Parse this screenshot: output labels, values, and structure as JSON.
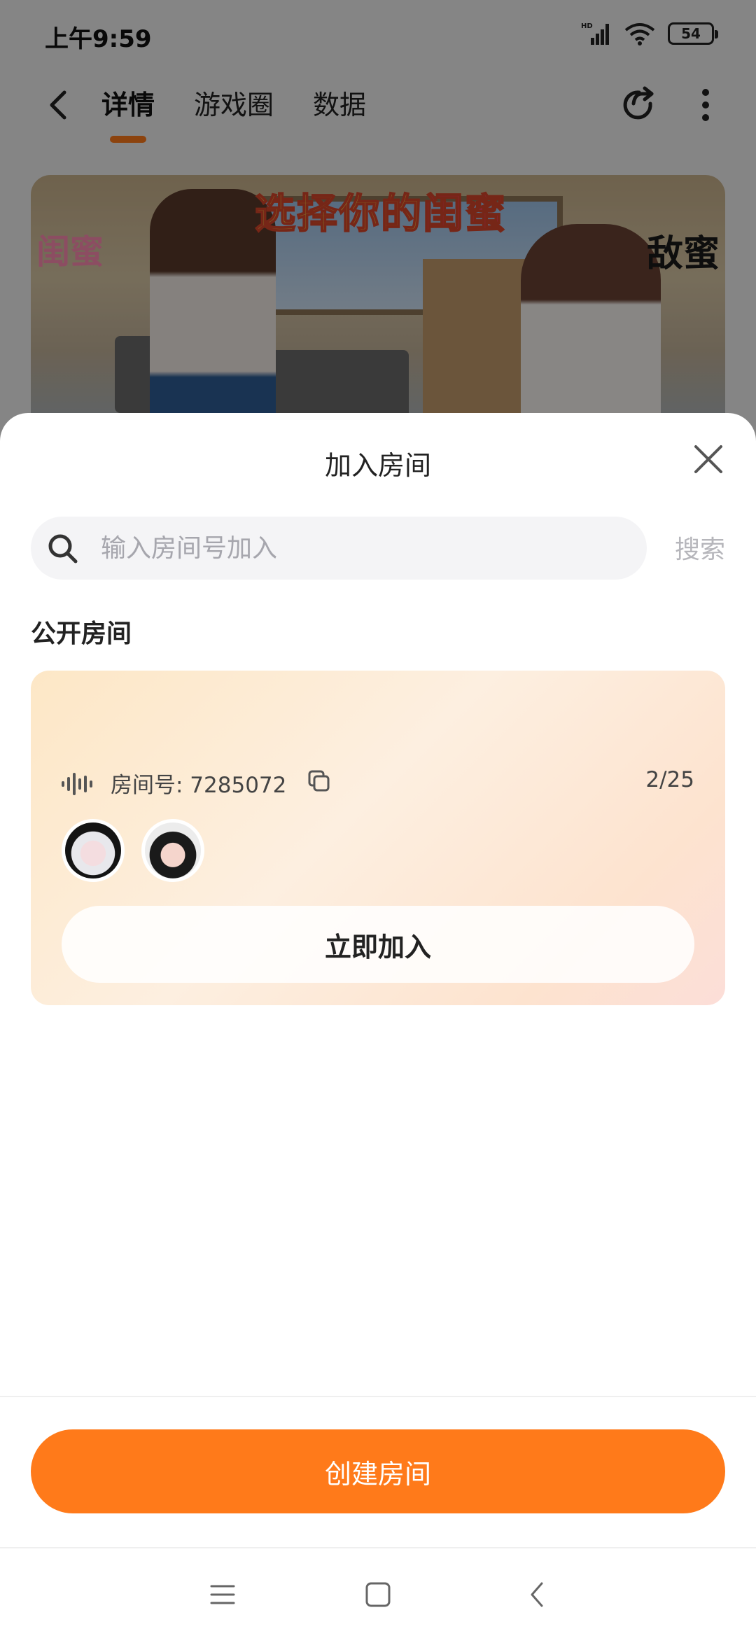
{
  "status_bar": {
    "time": "上午9:59",
    "signal_label": "HD",
    "battery": "54"
  },
  "nav": {
    "tabs": [
      {
        "label": "详情",
        "active": true
      },
      {
        "label": "游戏圈",
        "active": false
      },
      {
        "label": "数据",
        "active": false
      }
    ]
  },
  "banner": {
    "title_part1": "选择你的",
    "title_part2": "闺蜜",
    "left_label": "闺蜜",
    "right_label": "敌蜜"
  },
  "sheet": {
    "title": "加入房间",
    "search": {
      "placeholder": "输入房间号加入",
      "value": "",
      "button": "搜索"
    },
    "section_title": "公开房间",
    "rooms": [
      {
        "room_id_label": "房间号: 7285072",
        "count": "2/25",
        "join_label": "立即加入",
        "avatars": [
          "avatar-1",
          "avatar-2"
        ]
      }
    ],
    "create_label": "创建房间"
  },
  "colors": {
    "accent": "#ff7a1a",
    "card_gradient_start": "#fde7c6",
    "card_gradient_end": "#fcded8"
  }
}
